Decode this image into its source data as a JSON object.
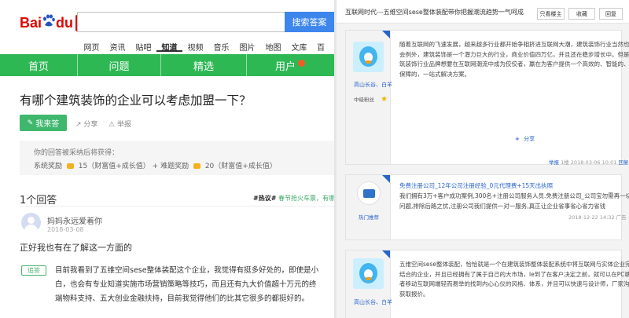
{
  "left": {
    "logo": {
      "bai": "Bai",
      "du": "du",
      "zhidao": "知道"
    },
    "search": {
      "button": "搜索答案"
    },
    "nav": [
      "网页",
      "资讯",
      "贴吧",
      "知道",
      "视频",
      "音乐",
      "图片",
      "地图",
      "文库",
      "百"
    ],
    "nav_active": "知道",
    "greenbar": [
      "首页",
      "问题",
      "精选",
      "用户"
    ],
    "question": {
      "title": "有哪个建筑装饰的企业可以考虑加盟一下？",
      "answer_button": "我来答",
      "share": "分享",
      "report": "举报"
    },
    "reward": {
      "line1": "你的回答被采纳后将获得：",
      "system_label": "系统奖励",
      "system_value": "15（财富值+成长值）",
      "plus": "+",
      "bounty_label": "难题奖励",
      "bounty_value": "20（财富值+成长值）"
    },
    "answer_count": "1个回答",
    "hot": {
      "tag": "#热议#",
      "link": "春节抢火车票，有哪"
    },
    "answer": {
      "user": "妈妈永远爱着你",
      "date": "2018-03-08",
      "line1": "正好我也有在了解这一方面的",
      "chase": "追答",
      "lines": [
        "目前我看到了五维空间sese整体装配这个企业，我觉得有挺多好处的，即使是小",
        "白，也会有专业知道实施市场营销策略等技巧，而且还有九大价值超十万元的终",
        "端物料支持、五大创业金融扶持，目前我觉得他们的比其它很多的都挺好的。"
      ]
    }
  },
  "right": {
    "title": "互联网时代---五维空间sese整体装配带你把握潮流趋势一气呵成",
    "buttons": [
      "只看楼主",
      "收藏",
      "回复"
    ],
    "post1": {
      "user": "高山长谷、白羊",
      "level": "中级粉丝",
      "lines": [
        "随着互联网的飞速发展，越来越多行业都开始争相挤进互联网大潮，建筑装饰行业当然也不",
        "会例外，建筑装饰是一个潜力巨大的行业，商业价值四万亿，并且还在稳步增长中。但是建",
        "筑装饰行业品牌想要在互联网潮流中成为佼佼者，赢在为客户提供一个高效的、智能的、有",
        "保障的，一站式解决方案。"
      ],
      "share": "分享",
      "report": "举报",
      "floor": "1楼",
      "date": "2018-03-06 10:01",
      "reply": "回复"
    },
    "ad": {
      "title": "免费注册公司_12年公司注册经验_0元代理费+15天出执照",
      "lines": [
        "我们拥有3万+客户成功案例,300名+注册公司服务人员.免费注册公司_公司宝勿需再一切",
        "问题,排除后路之忧,注册公司我们提供一对一服务,真正让企业省事省心省力省钱"
      ],
      "label": "热门推荐",
      "date": "2018-12-22 14:32",
      "ad_tag": "广告"
    },
    "post2": {
      "user": "高山长谷、白羊",
      "lines": [
        "五维空间sese整体装配，恰恰就是一个在建筑装饰整体装配系统中将互联网与实体企业完美",
        "结合的企业，并且已经拥有了属于自己的大市场，le到了在客户决定之前，就可以在PC端或",
        "者移动互联网端轻而易举的找到内心心仪的风格、体系，并且可以快速与设计师，厂家沟通",
        "获取报价。"
      ]
    }
  }
}
